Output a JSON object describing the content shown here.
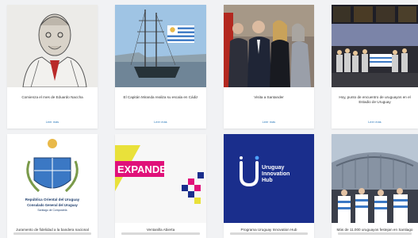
{
  "cards": [
    {
      "title": "Comienza el mes de Eduardo Naccha",
      "link": "Leer más",
      "image": "portrait-illustration"
    },
    {
      "title": "El Capitán Miranda realiza su escala en Cádiz",
      "link": "Leer más",
      "image": "tall-ship-with-uruguay-flag"
    },
    {
      "title": "Visita a Santander",
      "link": "Leer más",
      "image": "delegation-group-photo"
    },
    {
      "title": "Hoy, punto de encuentro de uruguayos en el Estadio de Uruguay",
      "link": "Leer más",
      "image": "people-holding-banner-at-night"
    },
    {
      "title": "Juramento de fidelidad a la bandera nacional",
      "image": "uruguay-coat-of-arms",
      "image_text": {
        "line1": "República Oriental del Uruguay",
        "line2": "Consulado General del Uruguay",
        "line3": "Santiago de Compostela"
      }
    },
    {
      "title": "Ventanilla Abierta",
      "image": "expande-logo",
      "image_text": {
        "brand": "EXPANDE"
      }
    },
    {
      "title": "Programa Uruguay Innovation Hub",
      "image": "uruguay-innovation-hub-logo",
      "image_text": {
        "line1": "Uruguay",
        "line2": "Innovation",
        "line3": "Hub"
      }
    },
    {
      "title": "Más de 11.000 uruguayos festejan en Santiago",
      "image": "stadium-crowd-with-flags"
    }
  ],
  "colors": {
    "link": "#1d6fb5",
    "hub_bg": "#1a2e8c",
    "expande_yellow": "#e9e13a",
    "expande_magenta": "#e0117a",
    "uruguay_blue": "#3b78c4",
    "sun_gold": "#e9b949"
  }
}
